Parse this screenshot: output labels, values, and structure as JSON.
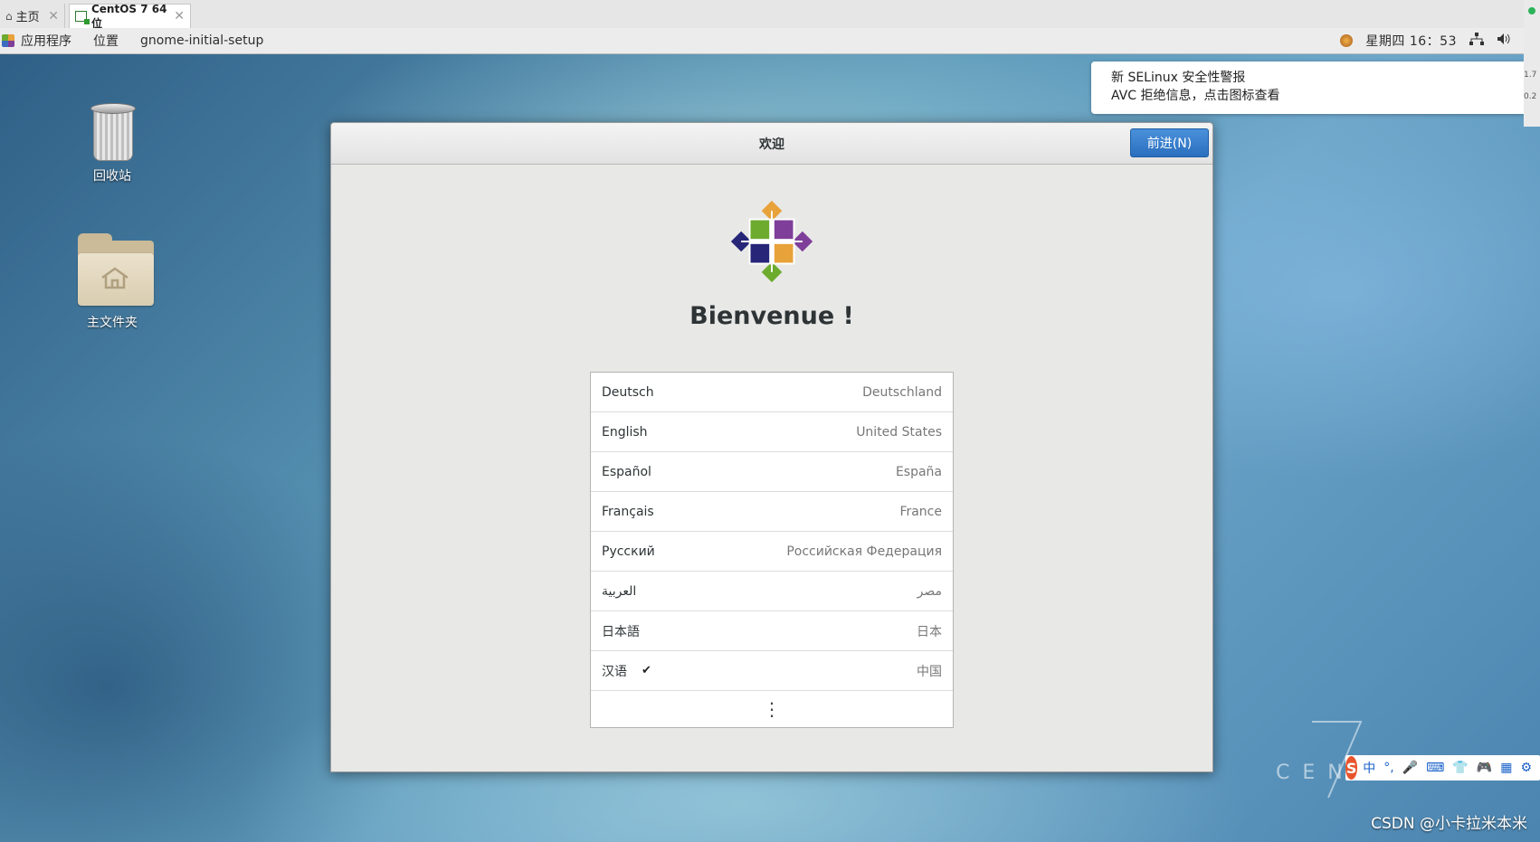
{
  "vm_tabs": [
    {
      "label": "主页",
      "icon": "home-icon"
    },
    {
      "label": "CentOS 7 64 位",
      "icon": "vm-icon"
    }
  ],
  "topbar": {
    "applications": "应用程序",
    "places": "位置",
    "app_name": "gnome-initial-setup",
    "clock": "星期四 16：53"
  },
  "desktop_icons": [
    {
      "label": "回收站",
      "icon": "trash-icon"
    },
    {
      "label": "主文件夹",
      "icon": "home-folder-icon"
    }
  ],
  "notification": {
    "title": "新 SELinux 安全性警报",
    "body": "AVC 拒绝信息，点击图标查看"
  },
  "side_indicator": {
    "line1": "1.7",
    "line2": "0.2"
  },
  "setup_window": {
    "title": "欢迎",
    "next_button": "前进(N)",
    "heading": "Bienvenue !",
    "languages": [
      {
        "name": "Deutsch",
        "region": "Deutschland",
        "selected": false
      },
      {
        "name": "English",
        "region": "United States",
        "selected": false
      },
      {
        "name": "Español",
        "region": "España",
        "selected": false
      },
      {
        "name": "Français",
        "region": "France",
        "selected": false
      },
      {
        "name": "Русский",
        "region": "Российская Федерация",
        "selected": false
      },
      {
        "name": "العربية",
        "region": "مصر",
        "selected": false
      },
      {
        "name": "日本語",
        "region": "日本",
        "selected": false
      },
      {
        "name": "汉语",
        "region": "中国",
        "selected": true
      }
    ],
    "more_symbol": "⋮",
    "check_symbol": "✔"
  },
  "watermark": {
    "version": "7",
    "brand": "CENT"
  },
  "ime": {
    "logo": "S",
    "mode": "中",
    "punct": "°,",
    "items": [
      "🎤",
      "⌨",
      "👕",
      "🎮",
      "▦",
      "⚙"
    ]
  },
  "credit": "CSDN @小卡拉米本米",
  "colors": {
    "accent": "#2a6fbf",
    "notification_bg": "#ffffff",
    "window_bg": "#e8e8e7"
  }
}
